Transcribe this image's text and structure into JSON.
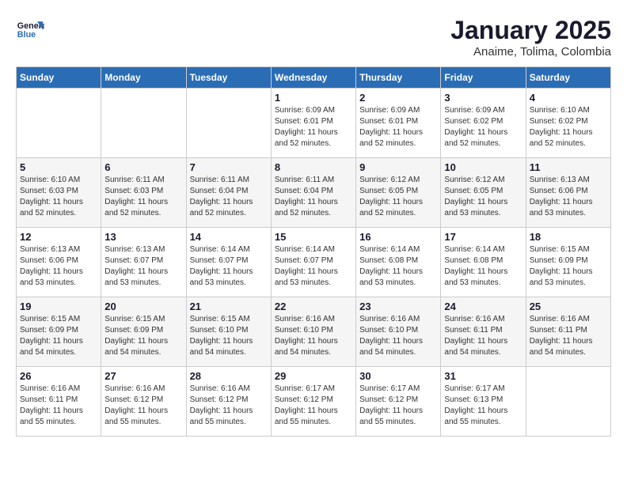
{
  "logo": {
    "line1": "General",
    "line2": "Blue"
  },
  "title": "January 2025",
  "subtitle": "Anaime, Tolima, Colombia",
  "header": {
    "days": [
      "Sunday",
      "Monday",
      "Tuesday",
      "Wednesday",
      "Thursday",
      "Friday",
      "Saturday"
    ]
  },
  "weeks": [
    [
      {
        "day": "",
        "info": ""
      },
      {
        "day": "",
        "info": ""
      },
      {
        "day": "",
        "info": ""
      },
      {
        "day": "1",
        "info": "Sunrise: 6:09 AM\nSunset: 6:01 PM\nDaylight: 11 hours\nand 52 minutes."
      },
      {
        "day": "2",
        "info": "Sunrise: 6:09 AM\nSunset: 6:01 PM\nDaylight: 11 hours\nand 52 minutes."
      },
      {
        "day": "3",
        "info": "Sunrise: 6:09 AM\nSunset: 6:02 PM\nDaylight: 11 hours\nand 52 minutes."
      },
      {
        "day": "4",
        "info": "Sunrise: 6:10 AM\nSunset: 6:02 PM\nDaylight: 11 hours\nand 52 minutes."
      }
    ],
    [
      {
        "day": "5",
        "info": "Sunrise: 6:10 AM\nSunset: 6:03 PM\nDaylight: 11 hours\nand 52 minutes."
      },
      {
        "day": "6",
        "info": "Sunrise: 6:11 AM\nSunset: 6:03 PM\nDaylight: 11 hours\nand 52 minutes."
      },
      {
        "day": "7",
        "info": "Sunrise: 6:11 AM\nSunset: 6:04 PM\nDaylight: 11 hours\nand 52 minutes."
      },
      {
        "day": "8",
        "info": "Sunrise: 6:11 AM\nSunset: 6:04 PM\nDaylight: 11 hours\nand 52 minutes."
      },
      {
        "day": "9",
        "info": "Sunrise: 6:12 AM\nSunset: 6:05 PM\nDaylight: 11 hours\nand 52 minutes."
      },
      {
        "day": "10",
        "info": "Sunrise: 6:12 AM\nSunset: 6:05 PM\nDaylight: 11 hours\nand 53 minutes."
      },
      {
        "day": "11",
        "info": "Sunrise: 6:13 AM\nSunset: 6:06 PM\nDaylight: 11 hours\nand 53 minutes."
      }
    ],
    [
      {
        "day": "12",
        "info": "Sunrise: 6:13 AM\nSunset: 6:06 PM\nDaylight: 11 hours\nand 53 minutes."
      },
      {
        "day": "13",
        "info": "Sunrise: 6:13 AM\nSunset: 6:07 PM\nDaylight: 11 hours\nand 53 minutes."
      },
      {
        "day": "14",
        "info": "Sunrise: 6:14 AM\nSunset: 6:07 PM\nDaylight: 11 hours\nand 53 minutes."
      },
      {
        "day": "15",
        "info": "Sunrise: 6:14 AM\nSunset: 6:07 PM\nDaylight: 11 hours\nand 53 minutes."
      },
      {
        "day": "16",
        "info": "Sunrise: 6:14 AM\nSunset: 6:08 PM\nDaylight: 11 hours\nand 53 minutes."
      },
      {
        "day": "17",
        "info": "Sunrise: 6:14 AM\nSunset: 6:08 PM\nDaylight: 11 hours\nand 53 minutes."
      },
      {
        "day": "18",
        "info": "Sunrise: 6:15 AM\nSunset: 6:09 PM\nDaylight: 11 hours\nand 53 minutes."
      }
    ],
    [
      {
        "day": "19",
        "info": "Sunrise: 6:15 AM\nSunset: 6:09 PM\nDaylight: 11 hours\nand 54 minutes."
      },
      {
        "day": "20",
        "info": "Sunrise: 6:15 AM\nSunset: 6:09 PM\nDaylight: 11 hours\nand 54 minutes."
      },
      {
        "day": "21",
        "info": "Sunrise: 6:15 AM\nSunset: 6:10 PM\nDaylight: 11 hours\nand 54 minutes."
      },
      {
        "day": "22",
        "info": "Sunrise: 6:16 AM\nSunset: 6:10 PM\nDaylight: 11 hours\nand 54 minutes."
      },
      {
        "day": "23",
        "info": "Sunrise: 6:16 AM\nSunset: 6:10 PM\nDaylight: 11 hours\nand 54 minutes."
      },
      {
        "day": "24",
        "info": "Sunrise: 6:16 AM\nSunset: 6:11 PM\nDaylight: 11 hours\nand 54 minutes."
      },
      {
        "day": "25",
        "info": "Sunrise: 6:16 AM\nSunset: 6:11 PM\nDaylight: 11 hours\nand 54 minutes."
      }
    ],
    [
      {
        "day": "26",
        "info": "Sunrise: 6:16 AM\nSunset: 6:11 PM\nDaylight: 11 hours\nand 55 minutes."
      },
      {
        "day": "27",
        "info": "Sunrise: 6:16 AM\nSunset: 6:12 PM\nDaylight: 11 hours\nand 55 minutes."
      },
      {
        "day": "28",
        "info": "Sunrise: 6:16 AM\nSunset: 6:12 PM\nDaylight: 11 hours\nand 55 minutes."
      },
      {
        "day": "29",
        "info": "Sunrise: 6:17 AM\nSunset: 6:12 PM\nDaylight: 11 hours\nand 55 minutes."
      },
      {
        "day": "30",
        "info": "Sunrise: 6:17 AM\nSunset: 6:12 PM\nDaylight: 11 hours\nand 55 minutes."
      },
      {
        "day": "31",
        "info": "Sunrise: 6:17 AM\nSunset: 6:13 PM\nDaylight: 11 hours\nand 55 minutes."
      },
      {
        "day": "",
        "info": ""
      }
    ]
  ]
}
